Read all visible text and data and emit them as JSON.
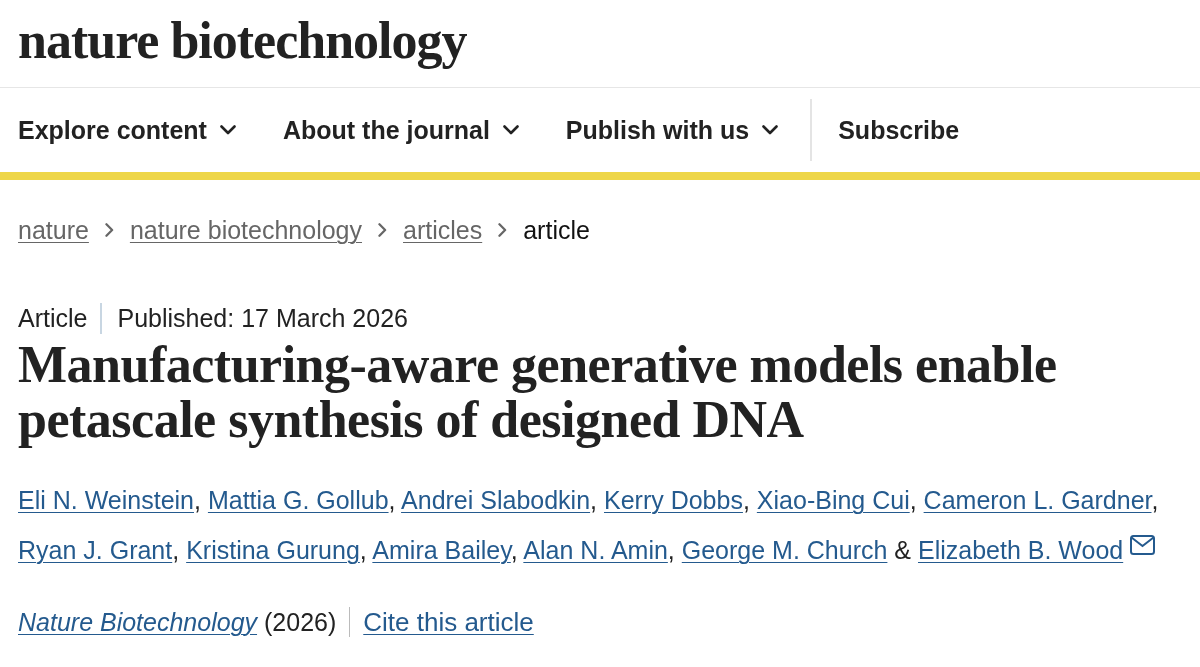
{
  "header": {
    "logo": "nature biotechnology"
  },
  "nav": {
    "menus": [
      {
        "label": "Explore content"
      },
      {
        "label": "About the journal"
      },
      {
        "label": "Publish with us"
      }
    ],
    "subscribe": "Subscribe"
  },
  "breadcrumb": [
    {
      "label": "nature",
      "current": false
    },
    {
      "label": "nature biotechnology",
      "current": false
    },
    {
      "label": "articles",
      "current": false
    },
    {
      "label": "article",
      "current": true
    }
  ],
  "article": {
    "type": "Article",
    "published": "Published: 17 March 2026",
    "title": "Manufacturing-aware generative models enable petascale synthesis of designed DNA",
    "authors": [
      {
        "name": "Eli N. Weinstein",
        "separator": {
          "kind": "comma",
          "text": ","
        },
        "corresponding": false
      },
      {
        "name": "Mattia G. Gollub",
        "separator": {
          "kind": "comma",
          "text": ","
        },
        "corresponding": false
      },
      {
        "name": "Andrei Slabodkin",
        "separator": {
          "kind": "comma",
          "text": ","
        },
        "corresponding": false
      },
      {
        "name": "Kerry Dobbs",
        "separator": {
          "kind": "comma",
          "text": ","
        },
        "corresponding": false
      },
      {
        "name": "Xiao-Bing Cui",
        "separator": {
          "kind": "comma",
          "text": ","
        },
        "corresponding": false
      },
      {
        "name": "Cameron L. Gardner",
        "separator": {
          "kind": "comma",
          "text": ","
        },
        "corresponding": false
      },
      {
        "name": "Ryan J. Grant",
        "separator": {
          "kind": "comma",
          "text": ","
        },
        "corresponding": false
      },
      {
        "name": "Kristina Gurung",
        "separator": {
          "kind": "comma",
          "text": ","
        },
        "corresponding": false
      },
      {
        "name": "Amira Bailey",
        "separator": {
          "kind": "comma",
          "text": ","
        },
        "corresponding": false
      },
      {
        "name": "Alan N. Amin",
        "separator": {
          "kind": "comma",
          "text": ","
        },
        "corresponding": false
      },
      {
        "name": "George M. Church",
        "separator": {
          "kind": "conjunction",
          "text": "&"
        },
        "corresponding": false
      },
      {
        "name": "Elizabeth B. Wood",
        "corresponding": true
      }
    ],
    "citation": {
      "journal": "Nature Biotechnology",
      "year": "(2026)"
    },
    "cite_link": "Cite this article"
  }
}
